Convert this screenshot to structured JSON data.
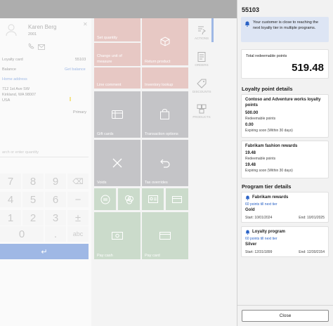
{
  "customer": {
    "name": "Karen Berg",
    "account": "2001",
    "loyalty_card_label": "Loyalty card",
    "loyalty_card_value": "55103",
    "balance_label": "Balance",
    "balance_link": "Get balance",
    "home_address_label": "Home address",
    "address_line1": "712 1st Ave SW",
    "address_line2": "Kirkland, WA 98007",
    "address_line3": "USA",
    "primary": "Primary"
  },
  "search_placeholder": "arch or enter quantity",
  "keypad": {
    "keys": [
      "7",
      "8",
      "9",
      "⌫",
      "4",
      "5",
      "6",
      "−",
      "1",
      "2",
      "3",
      "±",
      "0",
      ".",
      "abc"
    ],
    "enter": "↵"
  },
  "tiles": {
    "set_quantity": "Set quantity",
    "return_product": "Return product",
    "change_uom": "Change unit of measure",
    "line_comment": "Line comment",
    "inventory_lookup": "Inventory lookup",
    "gift_cards": "Gift cards",
    "transaction_options": "Transaction options",
    "voids": "Voids",
    "tax_overrides": "Tax overrides",
    "pay_cash": "Pay cash",
    "pay_card": "Pay card"
  },
  "side_nav": [
    "ACTIONS",
    "ORDERS",
    "DISCOUNTS",
    "PRODUCTS"
  ],
  "panel": {
    "title": "55103",
    "notice": "Your customer is close to reaching the next loyalty tier in multiple programs.",
    "total_label": "Total redeemable points",
    "total_value": "519.48",
    "details_heading": "Loyalty point details",
    "programs": [
      {
        "name": "Contoso and Adventure works loyalty points",
        "redeemable": "500.00",
        "redeemable_label": "Redeemable points",
        "expiring": "0.00",
        "expiring_label": "Expiring soon (Within 30 days)"
      },
      {
        "name": "Fabrikam fashion rewards",
        "redeemable": "19.48",
        "redeemable_label": "Redeemable points",
        "expiring": "19.48",
        "expiring_label": "Expiring soon (Within 30 days)"
      }
    ],
    "tier_heading": "Program tier details",
    "tiers": [
      {
        "name": "Fabrikam rewards",
        "next": "60 points till next tier",
        "tier": "Gold",
        "start": "Start: 10/01/2024",
        "end": "End: 10/01/2025"
      },
      {
        "name": "Loyalty program",
        "next": "60 points till next tier",
        "tier": "Silver",
        "start": "Start: 12/31/1899",
        "end": "End: 12/30/2154"
      }
    ],
    "close_label": "Close"
  },
  "colors": {
    "accent": "#2b63c6",
    "red_tile": "#c9857d",
    "gray_tile": "#7c7c84",
    "green_tile": "#8cb08c"
  }
}
